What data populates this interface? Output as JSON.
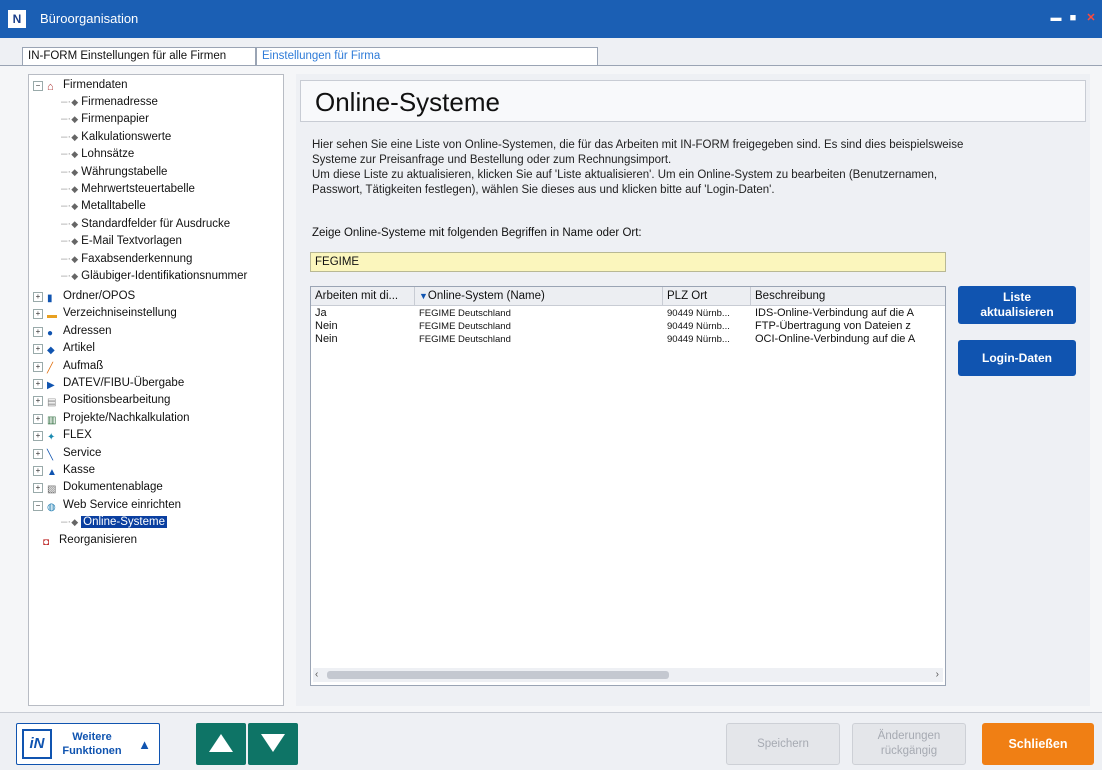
{
  "window": {
    "title": "Büroorganisation",
    "app_icon": "inform-logo-icon",
    "controls": [
      "minimize-icon",
      "maximize-icon",
      "close-icon"
    ]
  },
  "tabs": [
    {
      "label": "IN-FORM Einstellungen für alle Firmen",
      "active": false
    },
    {
      "label": "Einstellungen für Firma",
      "active": true
    }
  ],
  "tree": {
    "firmendaten": {
      "label": "Firmendaten",
      "children": [
        "Firmenadresse",
        "Firmenpapier",
        "Kalkulationswerte",
        "Lohnsätze",
        "Währungstabelle",
        "Mehrwertsteuertabelle",
        "Metalltabelle",
        "Standardfelder für Ausdrucke",
        "E-Mail Textvorlagen",
        "Faxabsenderkennung",
        "Gläubiger-Identifikationsnummer"
      ]
    },
    "items": [
      {
        "label": "Ordner/OPOS",
        "icon": "binder-icon"
      },
      {
        "label": "Verzeichniseinstellung",
        "icon": "folder-icon"
      },
      {
        "label": "Adressen",
        "icon": "contacts-icon"
      },
      {
        "label": "Artikel",
        "icon": "article-icon"
      },
      {
        "label": "Aufmaß",
        "icon": "pencil-icon"
      },
      {
        "label": "DATEV/FIBU-Übergabe",
        "icon": "play-icon"
      },
      {
        "label": "Positionsbearbeitung",
        "icon": "document-icon"
      },
      {
        "label": "Projekte/Nachkalkulation",
        "icon": "stack-icon"
      },
      {
        "label": "FLEX",
        "icon": "flex-icon"
      },
      {
        "label": "Service",
        "icon": "wrench-icon"
      },
      {
        "label": "Kasse",
        "icon": "register-icon"
      },
      {
        "label": "Dokumentenablage",
        "icon": "archive-icon"
      },
      {
        "label": "Web Service einrichten",
        "icon": "globe-icon"
      }
    ],
    "selected_child": "Online-Systeme",
    "last": {
      "label": "Reorganisieren",
      "icon": "reorganize-icon"
    }
  },
  "main": {
    "title": "Online-Systeme",
    "description": [
      "Hier sehen Sie eine Liste von Online-Systemen, die für das Arbeiten mit IN-FORM freigegeben sind. Es sind dies beispielsweise",
      "Systeme zur Preisanfrage und Bestellung oder zum Rechnungsimport.",
      "Um diese Liste zu aktualisieren, klicken Sie auf 'Liste aktualisieren'. Um ein Online-System zu bearbeiten (Benutzernamen,",
      "Passwort, Tätigkeiten festlegen), wählen Sie dieses aus und klicken bitte auf 'Login-Daten'."
    ],
    "filter_label": "Zeige Online-Systeme mit folgenden Begriffen in Name oder Ort:",
    "filter_value": "FEGIME",
    "table": {
      "columns": [
        "Arbeiten mit di...",
        "Online-System (Name)",
        "PLZ Ort",
        "Beschreibung"
      ],
      "sort_icon": "sort-down-icon",
      "rows": [
        [
          "Ja",
          "FEGIME Deutschland",
          "90449 Nürnb...",
          "IDS-Online-Verbindung auf die A"
        ],
        [
          "Nein",
          "FEGIME Deutschland",
          "90449 Nürnb...",
          "FTP-Übertragung von Dateien z"
        ],
        [
          "Nein",
          "FEGIME Deutschland",
          "90449 Nürnb...",
          "OCI-Online-Verbindung auf die A"
        ]
      ]
    },
    "buttons": {
      "refresh": [
        "Liste",
        "aktualisieren"
      ],
      "login": "Login-Daten"
    }
  },
  "footer": {
    "more": [
      "Weitere",
      "Funktionen"
    ],
    "save": "Speichern",
    "undo": [
      "Änderungen",
      "rückgängig"
    ],
    "close": "Schließen"
  },
  "colors": {
    "titlebar": "#1b5fb4",
    "accent_blue": "#1054b0",
    "filter_bg": "#fbf6bd",
    "nav_green": "#0e7466",
    "close_orange": "#f07f14",
    "selection": "#0a3fa0"
  }
}
